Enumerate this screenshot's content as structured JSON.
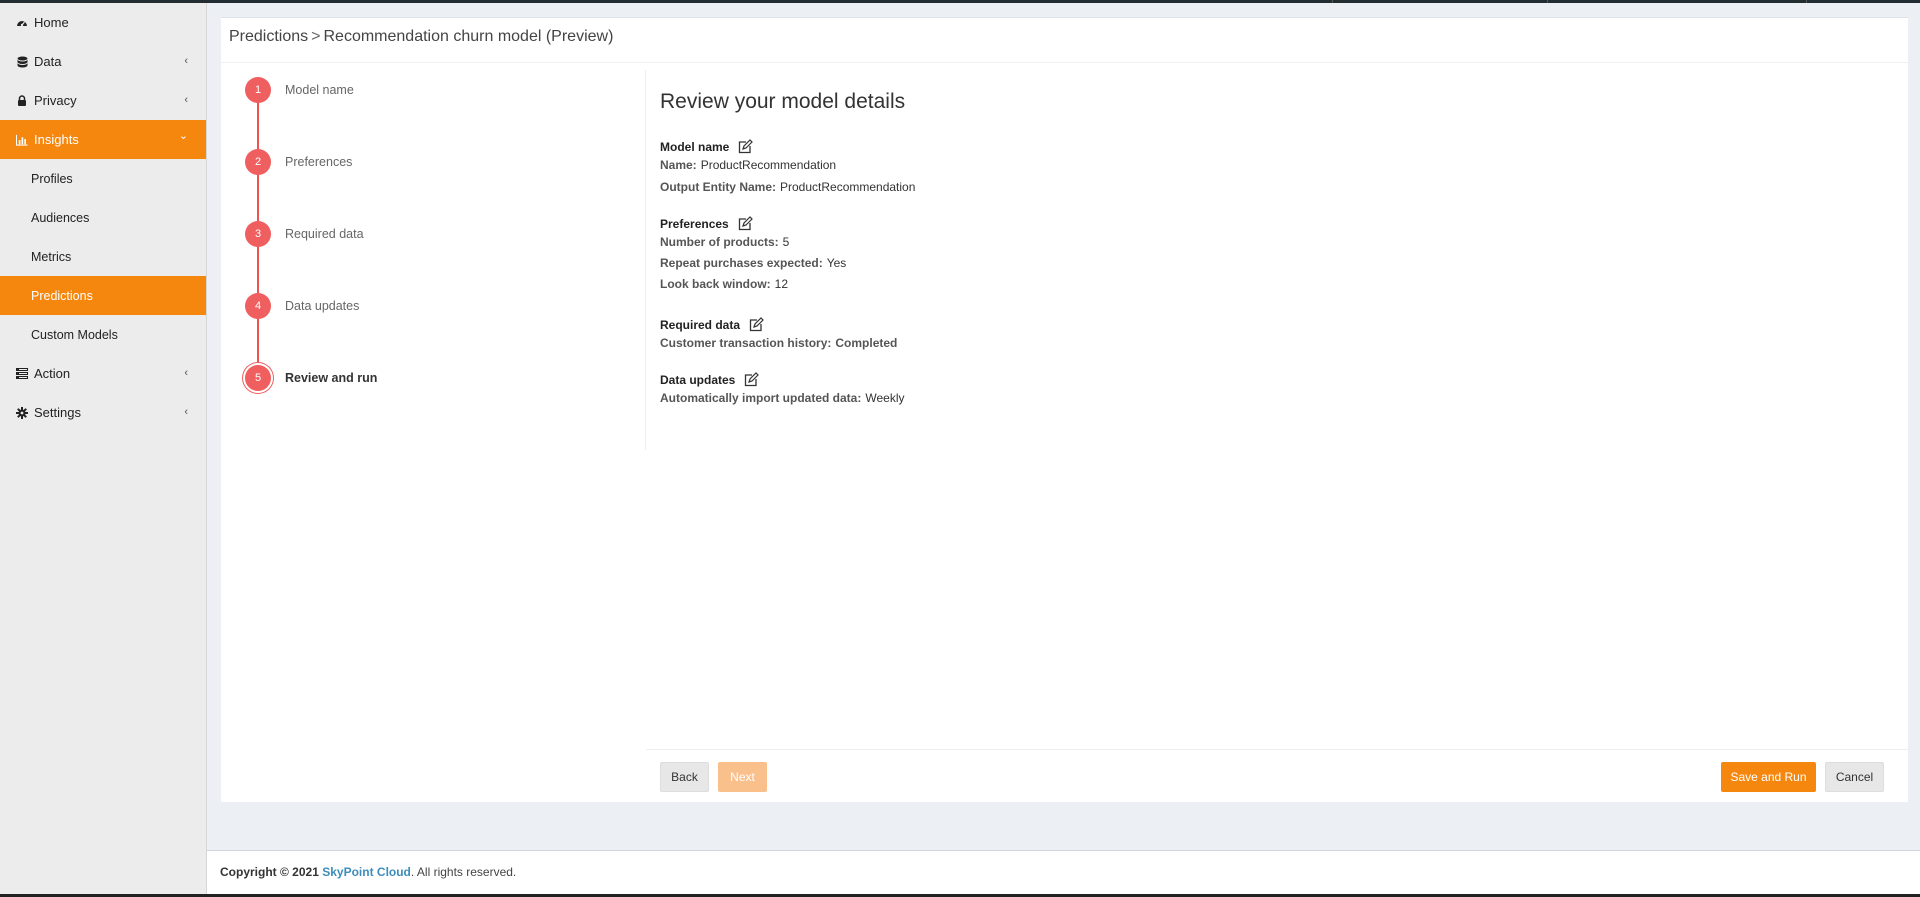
{
  "sidebar": {
    "home": "Home",
    "data": "Data",
    "privacy": "Privacy",
    "insights": "Insights",
    "profiles": "Profiles",
    "audiences": "Audiences",
    "metrics": "Metrics",
    "predictions": "Predictions",
    "custom_models": "Custom Models",
    "action": "Action",
    "settings": "Settings",
    "chevron_collapsed": "‹",
    "chevron_expanded": "⌄",
    "accent_color": "#f5870f"
  },
  "breadcrumb": {
    "parent": "Predictions",
    "separator": ">",
    "current": "Recommendation churn model (Preview)"
  },
  "steps": [
    {
      "number": "1",
      "label": "Model name"
    },
    {
      "number": "2",
      "label": "Preferences"
    },
    {
      "number": "3",
      "label": "Required data"
    },
    {
      "number": "4",
      "label": "Data updates"
    },
    {
      "number": "5",
      "label": "Review and run"
    }
  ],
  "review": {
    "title": "Review your model details",
    "model_name": {
      "title": "Model name",
      "name_key": "Name:",
      "name_val": "ProductRecommendation",
      "entity_key": "Output Entity Name:",
      "entity_val": "ProductRecommendation"
    },
    "preferences": {
      "title": "Preferences",
      "products_key": "Number of products:",
      "products_val": "5",
      "repeat_key": "Repeat purchases expected:",
      "repeat_val": "Yes",
      "lookback_key": "Look back window:",
      "lookback_val": "12"
    },
    "required_data": {
      "title": "Required data",
      "history_key": "Customer transaction history:",
      "history_val": "Completed"
    },
    "data_updates": {
      "title": "Data updates",
      "import_key": "Automatically import updated data:",
      "import_val": "Weekly"
    }
  },
  "buttons": {
    "back": "Back",
    "next": "Next",
    "save_run": "Save and Run",
    "cancel": "Cancel"
  },
  "footer": {
    "copyright": "Copyright © 2021",
    "brand": "SkyPoint Cloud",
    "rights": ". All rights reserved."
  }
}
